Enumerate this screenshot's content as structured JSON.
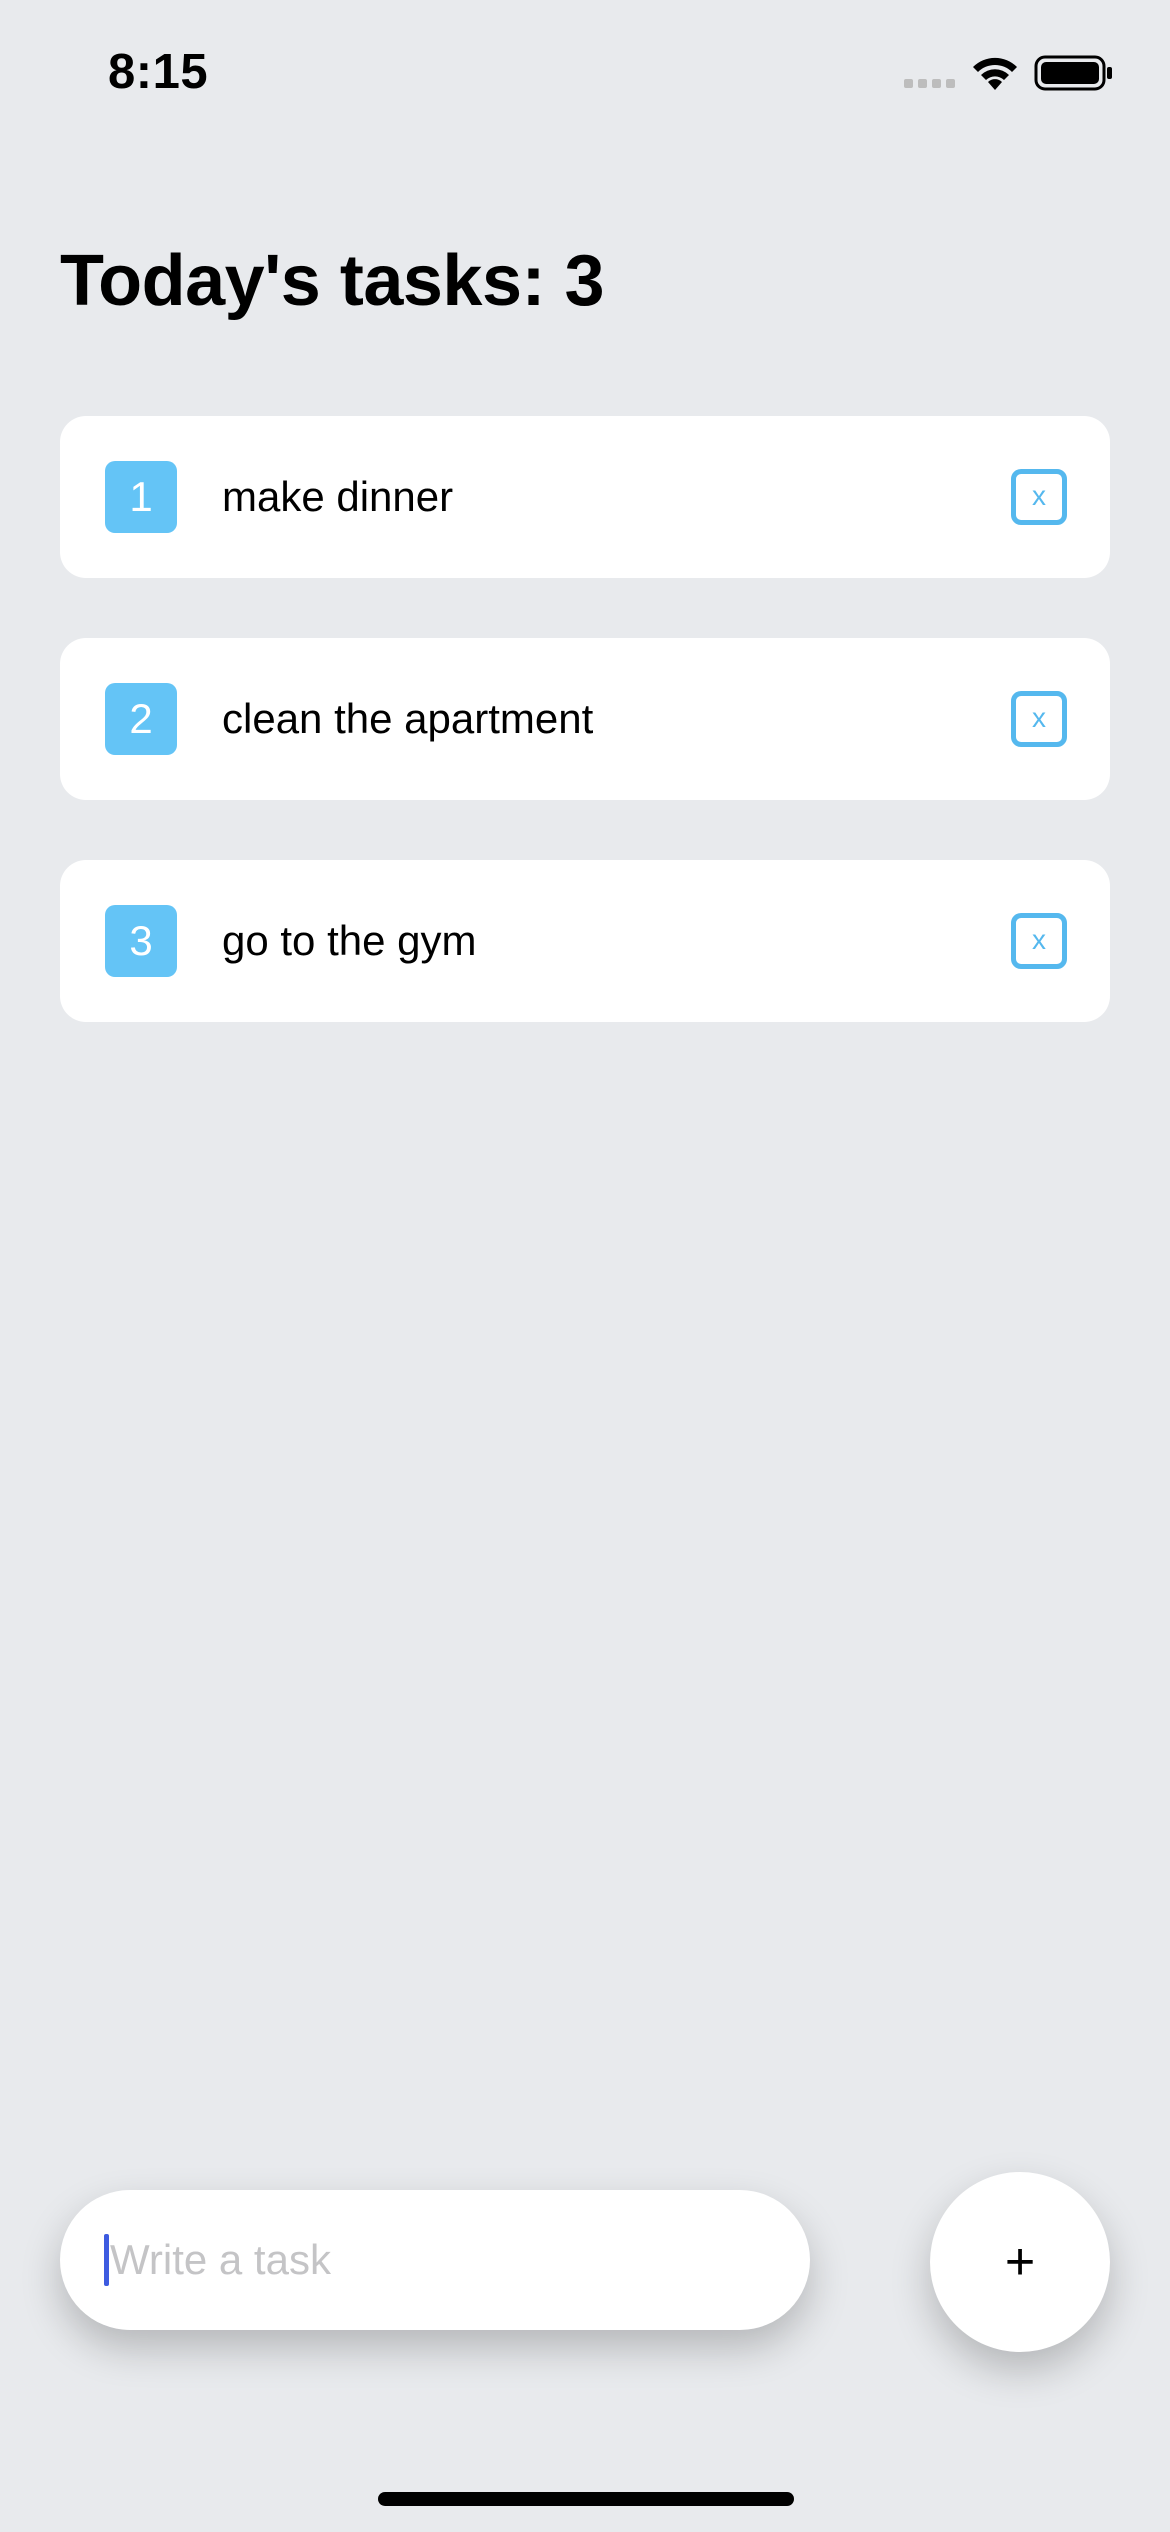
{
  "status_bar": {
    "time": "8:15",
    "icons": [
      "cellular-signal-icon",
      "wifi-icon",
      "battery-icon"
    ]
  },
  "header": {
    "title": "Today's tasks: 3"
  },
  "tasks": [
    {
      "number": "1",
      "text": "make dinner",
      "delete_label": "x"
    },
    {
      "number": "2",
      "text": "clean the apartment",
      "delete_label": "x"
    },
    {
      "number": "3",
      "text": "go to the gym",
      "delete_label": "x"
    }
  ],
  "composer": {
    "input_placeholder": "Write a task",
    "input_value": "",
    "add_button_label": "+"
  },
  "colors": {
    "background": "#E8EAED",
    "card": "#FFFFFF",
    "number_badge": "#64C4F6",
    "delete_border": "#55B8EE",
    "cursor": "#3D5BE0"
  }
}
